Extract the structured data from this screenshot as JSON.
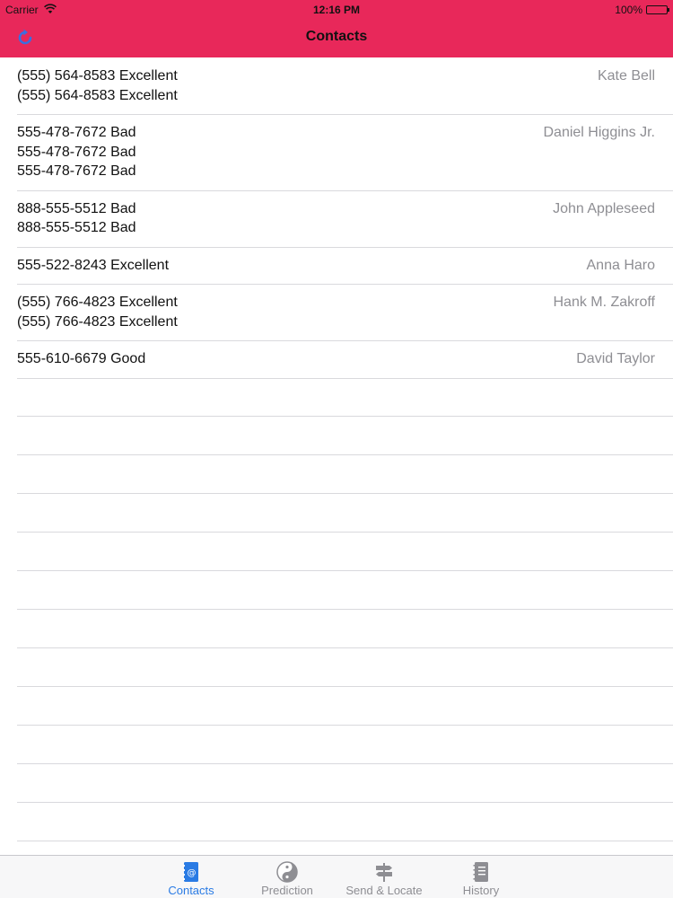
{
  "status_bar": {
    "carrier": "Carrier",
    "time": "12:16 PM",
    "battery": "100%"
  },
  "nav": {
    "title": "Contacts",
    "refresh_icon": "refresh-icon"
  },
  "contacts": [
    {
      "name": "Kate Bell",
      "phones": [
        "(555) 564-8583 Excellent",
        "(555) 564-8583 Excellent"
      ]
    },
    {
      "name": "Daniel Higgins Jr.",
      "phones": [
        "555-478-7672 Bad",
        "555-478-7672 Bad",
        "555-478-7672 Bad"
      ]
    },
    {
      "name": "John Appleseed",
      "phones": [
        "888-555-5512 Bad",
        "888-555-5512 Bad"
      ]
    },
    {
      "name": "Anna Haro",
      "phones": [
        "555-522-8243 Excellent"
      ]
    },
    {
      "name": "Hank M. Zakroff",
      "phones": [
        "(555) 766-4823 Excellent",
        "(555) 766-4823 Excellent"
      ]
    },
    {
      "name": "David Taylor",
      "phones": [
        "555-610-6679 Good"
      ]
    }
  ],
  "tabs": [
    {
      "label": "Contacts",
      "icon": "contacts-icon",
      "active": true
    },
    {
      "label": "Prediction",
      "icon": "yin-yang-icon",
      "active": false
    },
    {
      "label": "Send & Locate",
      "icon": "signpost-icon",
      "active": false
    },
    {
      "label": "History",
      "icon": "notebook-icon",
      "active": false
    }
  ],
  "colors": {
    "nav_background": "#e8285a",
    "tab_active": "#2a7be4",
    "tab_inactive": "#8e8e93",
    "secondary_text": "#8e8e93"
  }
}
